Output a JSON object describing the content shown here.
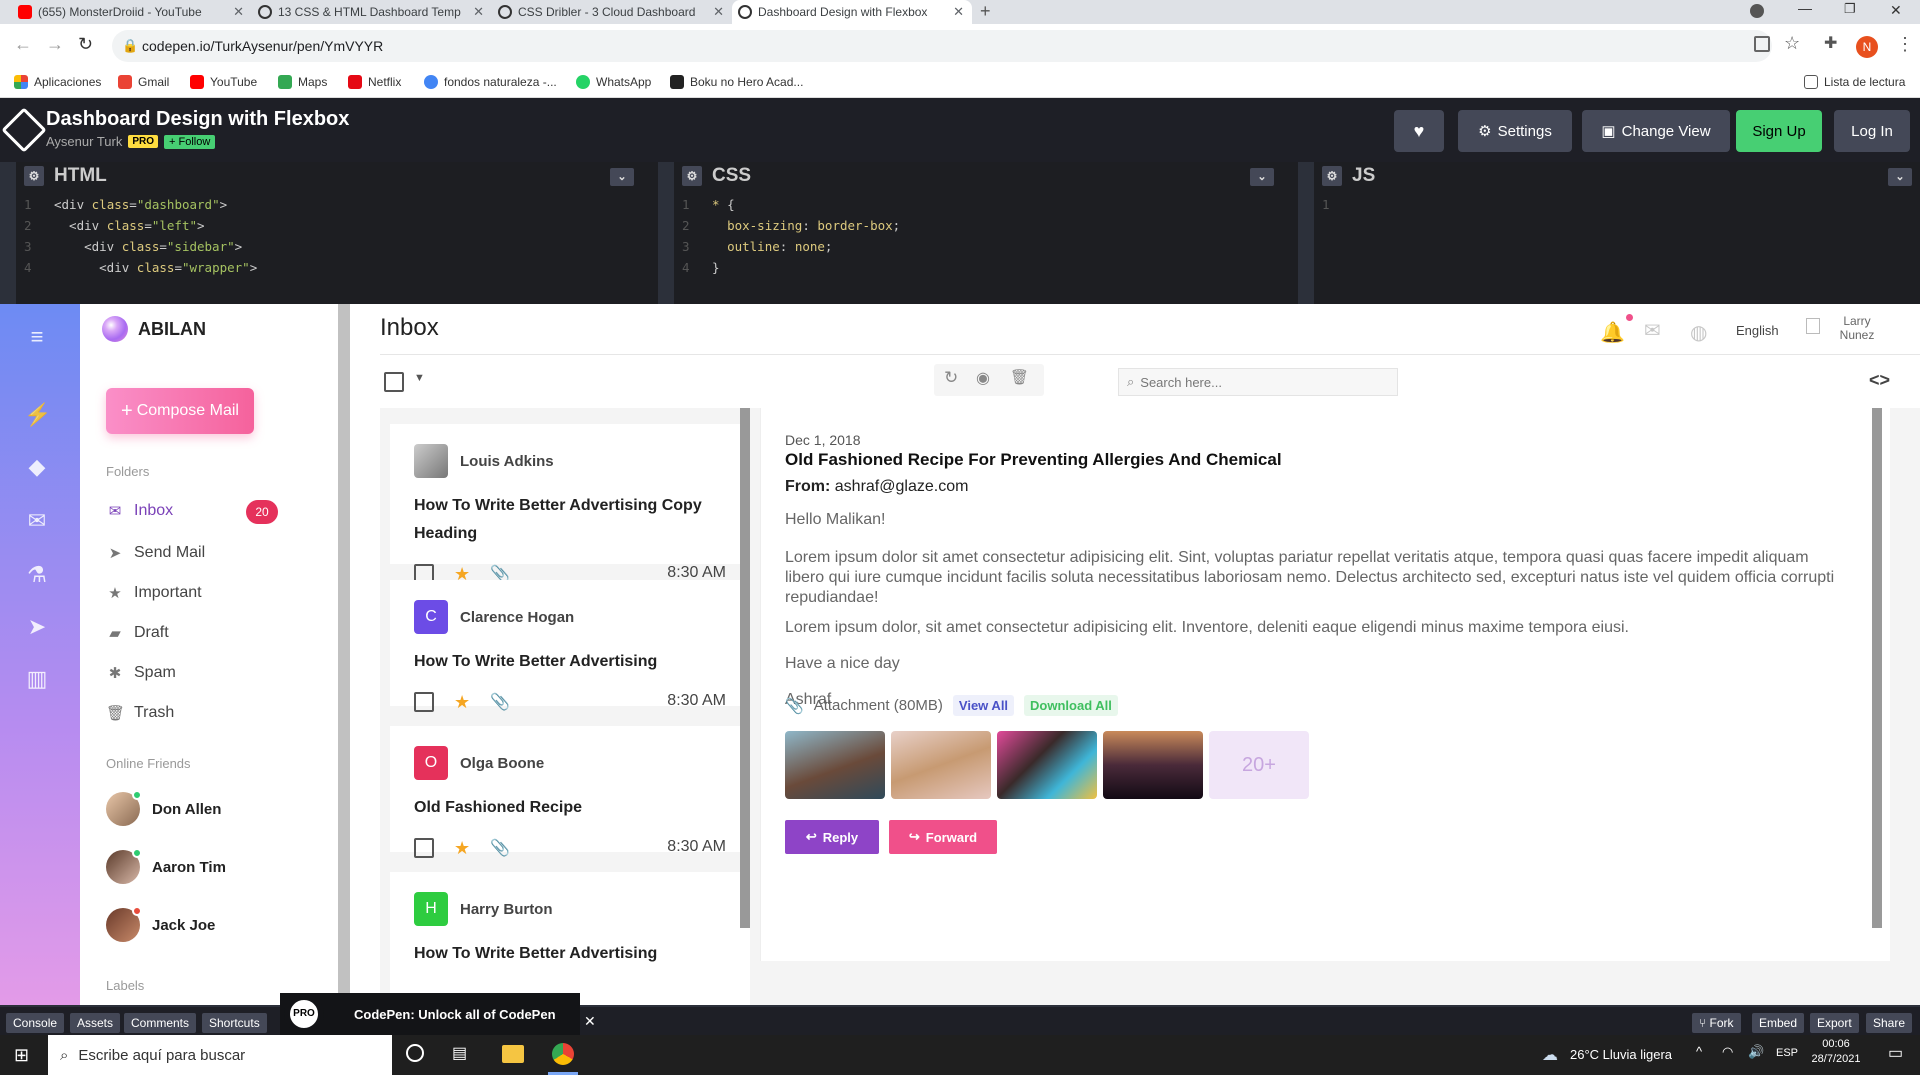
{
  "tabs": [
    {
      "title": "(655) MonsterDroiid - YouTube",
      "color": "#ff0000"
    },
    {
      "title": "13 CSS & HTML Dashboard Temp",
      "color": "#333333"
    },
    {
      "title": "CSS Dribler - 3 Cloud Dashboard",
      "color": "#333333"
    },
    {
      "title": "Dashboard Design with Flexbox",
      "color": "#333333"
    }
  ],
  "address": "codepen.io/TurkAysenur/pen/YmVYYR",
  "profile_initial": "N",
  "bookmarks": [
    "Aplicaciones",
    "Gmail",
    "YouTube",
    "Maps",
    "Netflix",
    "fondos naturaleza -...",
    "WhatsApp",
    "Boku no Hero Acad..."
  ],
  "reading_list": "Lista de lectura",
  "codepen": {
    "title": "Dashboard Design with Flexbox",
    "author": "Aysenur Turk",
    "pro_badge": "PRO",
    "follow": "+ Follow",
    "settings": "Settings",
    "change_view": "Change View",
    "sign_up": "Sign Up",
    "log_in": "Log In"
  },
  "editors": {
    "html_label": "HTML",
    "css_label": "CSS",
    "js_label": "JS"
  },
  "dashboard": {
    "brand": "ABILAN",
    "compose": "Compose Mail",
    "folders_heading": "Folders",
    "folders": [
      {
        "label": "Inbox",
        "icon": "mail-icon"
      },
      {
        "label": "Send Mail",
        "icon": "send-icon"
      },
      {
        "label": "Important",
        "icon": "star-icon"
      },
      {
        "label": "Draft",
        "icon": "draft-icon"
      },
      {
        "label": "Spam",
        "icon": "bug-icon"
      },
      {
        "label": "Trash",
        "icon": "trash-icon"
      }
    ],
    "inbox_count": "20",
    "friends_heading": "Online Friends",
    "friends": [
      {
        "name": "Don Allen",
        "status_color": "#2ecc71"
      },
      {
        "name": "Aaron Tim",
        "status_color": "#2ecc71"
      },
      {
        "name": "Jack Joe",
        "status_color": "#e74c3c"
      }
    ],
    "labels_heading": "Labels",
    "page_title": "Inbox",
    "language": "English",
    "user": "Larry Nunez",
    "search_placeholder": "Search here...",
    "messages": [
      {
        "from": "Louis Adkins",
        "initial": "",
        "color": "#888888",
        "subject": "How To Write Better Advertising Copy Heading",
        "time": "8:30 AM"
      },
      {
        "from": "Clarence Hogan",
        "initial": "C",
        "color": "#6c4ce6",
        "subject": "How To Write Better Advertising",
        "time": "8:30 AM"
      },
      {
        "from": "Olga Boone",
        "initial": "O",
        "color": "#e5315b",
        "subject": "Old Fashioned Recipe",
        "time": "8:30 AM"
      },
      {
        "from": "Harry Burton",
        "initial": "H",
        "color": "#2ecc40",
        "subject": "How To Write Better Advertising",
        "time": ""
      }
    ],
    "detail": {
      "date": "Dec 1, 2018",
      "title": "Old Fashioned Recipe For Preventing Allergies And Chemical",
      "from_label": "From:",
      "from": "ashraf@glaze.com",
      "greeting": "Hello Malikan!",
      "para1": "Lorem ipsum dolor sit amet consectetur adipisicing elit. Sint, voluptas pariatur repellat veritatis atque, tempora quasi quas facere impedit aliquam libero qui iure cumque incidunt facilis soluta necessitatibus laboriosam nemo. Delectus architecto sed, excepturi natus iste vel quidem officia corrupti repudiandae!",
      "para2": "Lorem ipsum dolor, sit amet consectetur adipisicing elit. Inventore, deleniti eaque eligendi minus maxime tempora eiusi.",
      "sign1": "Have a nice day",
      "sign2": "Ashraf",
      "attachment": "Attachment (80MB)",
      "view_all": "View All",
      "download_all": "Download All",
      "more": "20+",
      "reply": "Reply",
      "forward": "Forward"
    }
  },
  "footer": {
    "console": "Console",
    "assets": "Assets",
    "comments": "Comments",
    "shortcuts": "Shortcuts",
    "promo": "CodePen: Unlock all of CodePen",
    "pro": "PRO",
    "fork": "Fork",
    "embed": "Embed",
    "export": "Export",
    "share": "Share"
  },
  "taskbar": {
    "search": "Escribe aquí para buscar",
    "weather": "26°C  Lluvia ligera",
    "lang": "ESP",
    "time": "00:06",
    "date": "28/7/2021"
  }
}
